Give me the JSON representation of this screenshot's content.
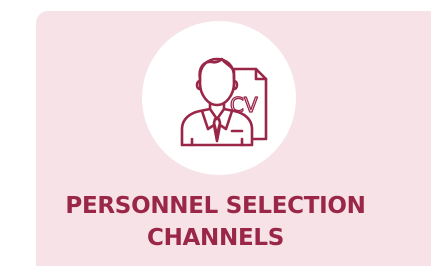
{
  "card": {
    "title_line1": "PERSONNEL SELECTION",
    "title_line2": "CHANNELS",
    "icon": "candidate-cv-icon",
    "cv_text": "CV"
  },
  "colors": {
    "card_background": "#f6e2e7",
    "accent": "#9a2648",
    "circle": "#ffffff"
  }
}
